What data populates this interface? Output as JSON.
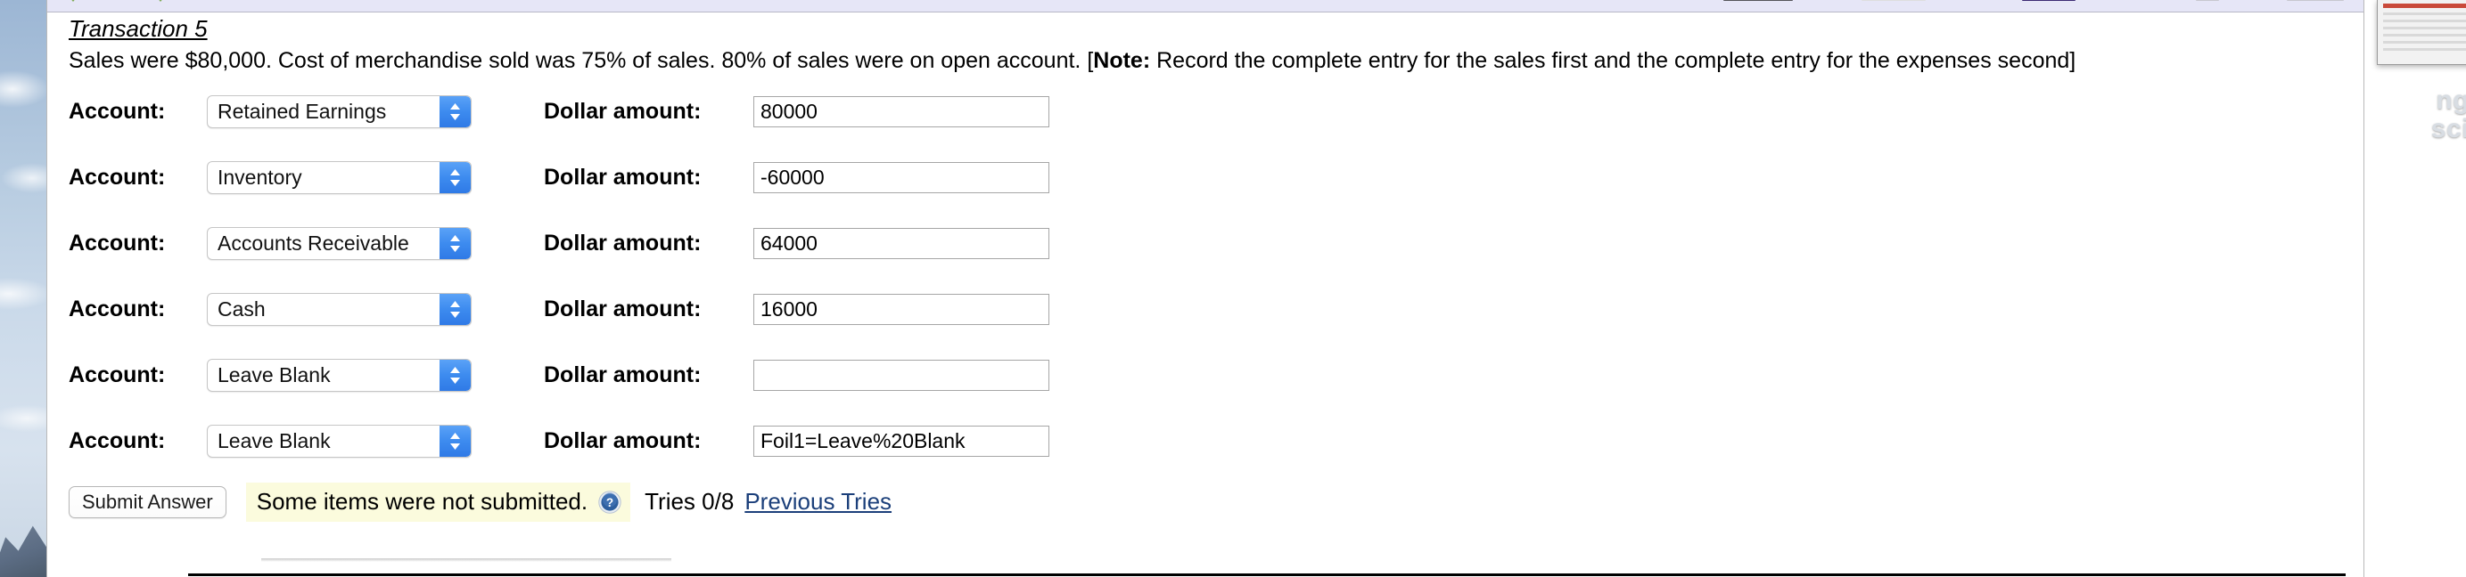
{
  "wallpaper": {
    "right_text_line1": "ng",
    "right_text_line2": "sci"
  },
  "transaction": {
    "heading": "Transaction 5",
    "body_part1": "Sales were $80,000. Cost of merchandise sold was 75% of sales. 80% of sales were on open account. [",
    "body_note_label": "Note:",
    "body_part2": " Record the complete entry for the sales first and the complete entry for the expenses second]"
  },
  "form": {
    "account_label": "Account:",
    "dollar_label": "Dollar amount:",
    "rows": [
      {
        "account": "Retained Earnings",
        "amount": "80000"
      },
      {
        "account": "Inventory",
        "amount": "-60000"
      },
      {
        "account": "Accounts Receivable",
        "amount": "64000"
      },
      {
        "account": "Cash",
        "amount": "16000"
      },
      {
        "account": "Leave Blank",
        "amount": ""
      },
      {
        "account": "Leave Blank",
        "amount": "Foil1=Leave%20Blank"
      }
    ]
  },
  "footer": {
    "submit_label": "Submit Answer",
    "status_message": "Some items were not submitted.",
    "tries_text": "Tries 0/8",
    "previous_tries_label": "Previous Tries",
    "status_bg": "#fbfbdd",
    "link_color": "#1b3f7a"
  }
}
